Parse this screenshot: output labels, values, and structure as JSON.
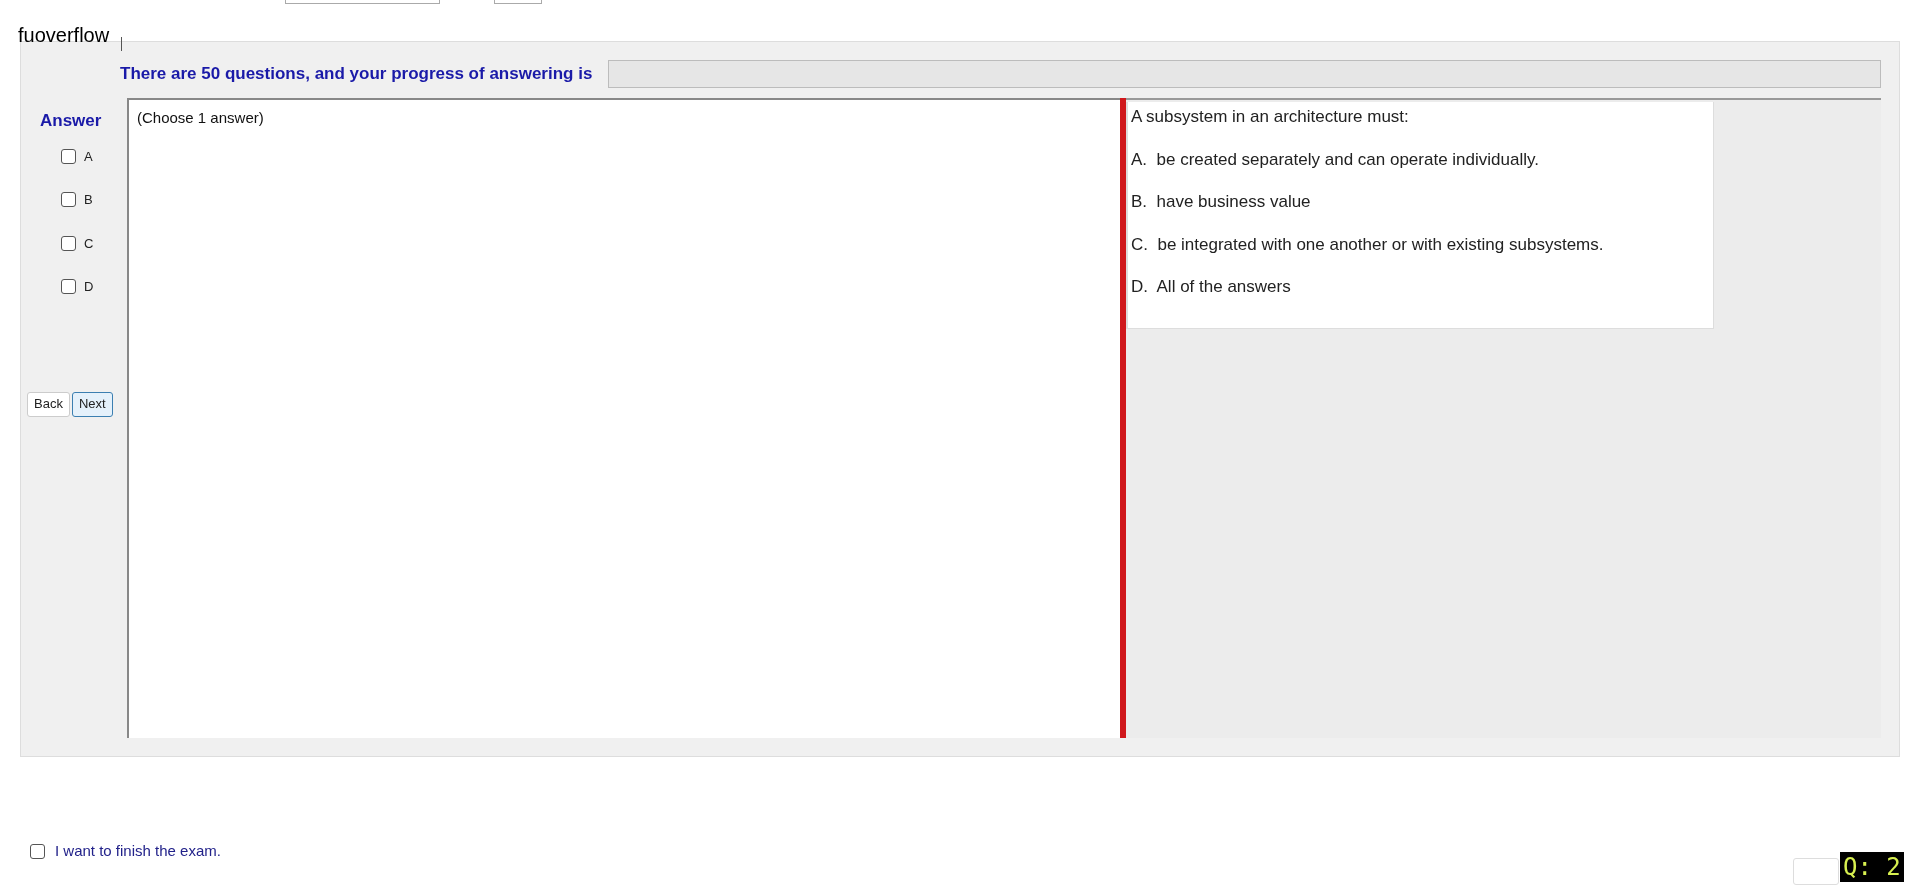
{
  "header": {
    "title": "fuoverflow"
  },
  "progress": {
    "label": "There are 50 questions, and your progress of answering is",
    "level": 0
  },
  "answer": {
    "label": "Answer",
    "options": [
      {
        "letter": "A",
        "checked": false
      },
      {
        "letter": "B",
        "checked": false
      },
      {
        "letter": "C",
        "checked": false
      },
      {
        "letter": "D",
        "checked": false
      }
    ]
  },
  "nav": {
    "back": "Back",
    "next": "Next"
  },
  "instruction": "(Choose 1 answer)",
  "question": {
    "stem": "A subsystem in an architecture must:",
    "choices": [
      {
        "letter": "A.",
        "text": "be created separately and can operate individually."
      },
      {
        "letter": "B.",
        "text": "have business value"
      },
      {
        "letter": "C.",
        "text": "be integrated with one another or with existing subsystems."
      },
      {
        "letter": "D.",
        "text": "All of the answers"
      }
    ]
  },
  "finish": {
    "label": "I want to finish the exam.",
    "checked": false
  },
  "question_badge": "Q: 2"
}
